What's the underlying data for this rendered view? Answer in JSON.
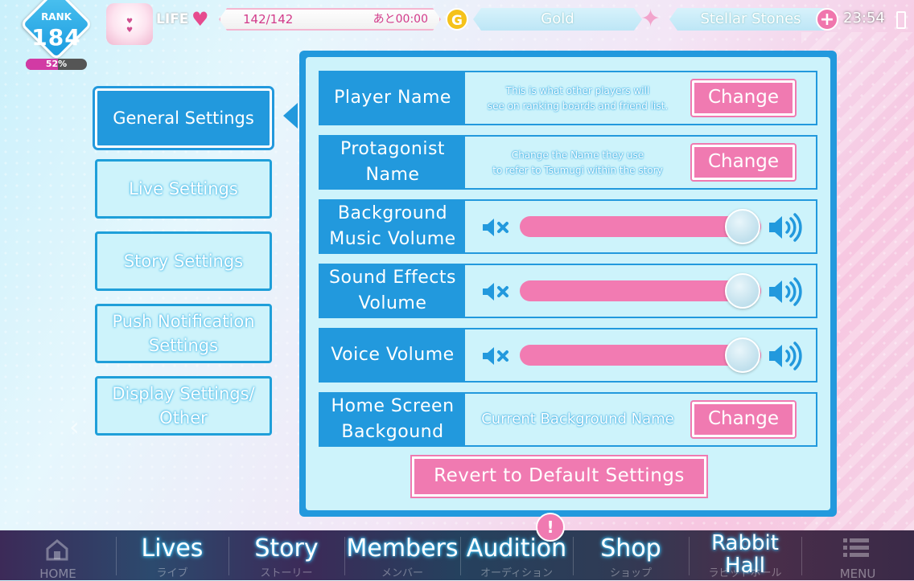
{
  "header": {
    "rank_label": "RANK",
    "rank_value": "184",
    "rank_progress_label": "52%",
    "rank_progress": 0.52,
    "life_label": "LIFE",
    "life_value": "142/142",
    "life_timer": "あと00:00",
    "gold_icon_text": "G",
    "gold_label": "Gold",
    "stones_label": "Stellar Stones",
    "clock": "23:54"
  },
  "menu": {
    "items": [
      {
        "label": "General Settings",
        "active": true
      },
      {
        "label": "Live Settings"
      },
      {
        "label": "Story Settings"
      },
      {
        "label": "Push Notification Settings"
      },
      {
        "label": "Display Settings/ Other"
      }
    ]
  },
  "settings": {
    "player_name": {
      "label": "Player Name",
      "desc_line1": "This is what other players will",
      "desc_line2": "see on ranking boards and friend list.",
      "button": "Change"
    },
    "protagonist_name": {
      "label_line1": "Protagonist",
      "label_line2": "Name",
      "desc_line1": "Change the Name they use",
      "desc_line2": "to refer to Tsumugi within the story",
      "button": "Change"
    },
    "bgm": {
      "label_line1": "Background",
      "label_line2": "Music Volume",
      "level": 0.95
    },
    "se": {
      "label_line1": "Sound Effects",
      "label_line2": "Volume",
      "level": 0.95
    },
    "voice": {
      "label": "Voice Volume",
      "level": 0.95
    },
    "home_bg": {
      "label_line1": "Home Screen",
      "label_line2": "Backgound",
      "current": "Current Background Name",
      "button": "Change"
    },
    "revert_button": "Revert to Default Settings"
  },
  "nav": {
    "home": {
      "label": "HOME"
    },
    "lives": {
      "label": "Lives",
      "sub": "ライブ"
    },
    "story": {
      "label": "Story",
      "sub": "ストーリー"
    },
    "members": {
      "label": "Members",
      "sub": "メンバー"
    },
    "audition": {
      "label": "Audition",
      "sub": "オーディション",
      "badge": "!"
    },
    "shop": {
      "label": "Shop",
      "sub": "ショップ"
    },
    "rabbit_hall": {
      "label_line1": "Rabbit",
      "label_line2": "Hall",
      "sub": "ラビットホール"
    },
    "menu": {
      "label": "MENU"
    }
  },
  "colors": {
    "accent_blue": "#2299dd",
    "accent_pink": "#f07ab1",
    "panel_bg": "#cdf3fb"
  }
}
